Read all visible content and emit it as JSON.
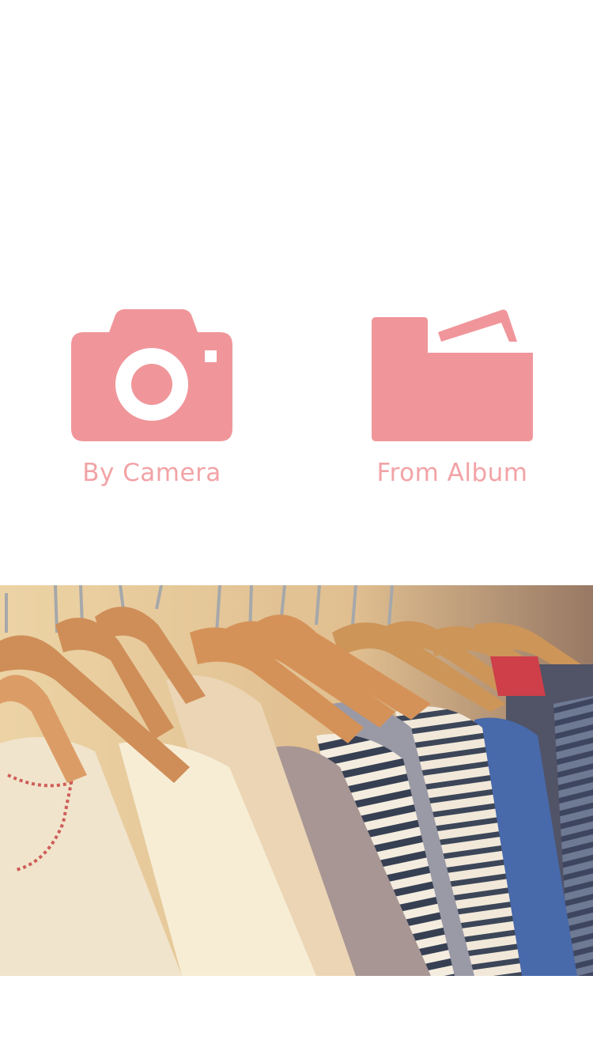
{
  "colors": {
    "accent": "#f0969b",
    "label": "#f2a3a6",
    "background": "#ffffff"
  },
  "options": {
    "camera": {
      "label": "By Camera",
      "icon": "camera-icon"
    },
    "album": {
      "label": "From Album",
      "icon": "folder-icon"
    }
  },
  "banner": {
    "subject": "clothes-rack-photo"
  }
}
